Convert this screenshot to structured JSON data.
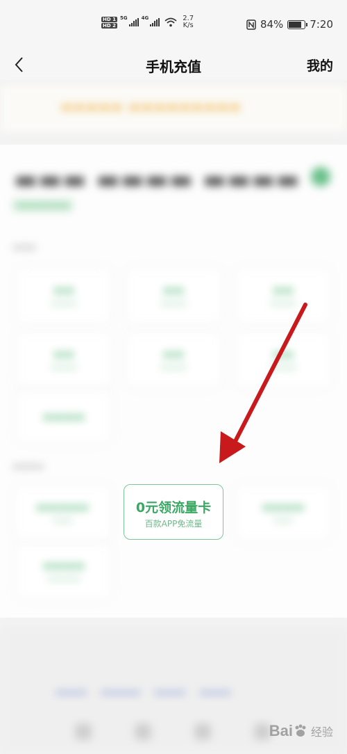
{
  "status_bar": {
    "hd1": "HD 1",
    "hd2": "HD 2",
    "net1": "5G",
    "net2": "4G",
    "speed_value": "2.7",
    "speed_unit": "K/s",
    "battery": "84%",
    "battery_level": 0.84,
    "time": "7:20"
  },
  "header": {
    "title": "手机充值",
    "right_link": "我的"
  },
  "focus_tile": {
    "title": "0元领流量卡",
    "subtitle": "百款APP免流量"
  },
  "watermark": {
    "brand": "Bai",
    "suffix": "经验"
  },
  "colors": {
    "accent_green": "#3aa862",
    "arrow_red": "#c8191c"
  },
  "icons": {
    "back": "chevron-left-icon",
    "nfc": "nfc-icon",
    "wifi": "wifi-icon"
  }
}
